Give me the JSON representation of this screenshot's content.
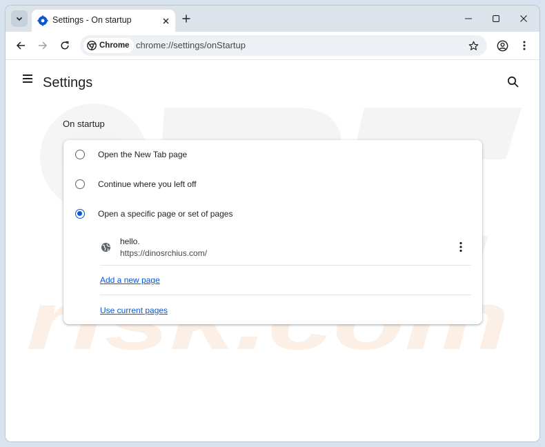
{
  "tab": {
    "title": "Settings - On startup"
  },
  "omnibox": {
    "chip_label": "Chrome",
    "url": "chrome://settings/onStartup"
  },
  "page": {
    "title": "Settings"
  },
  "on_startup": {
    "heading": "On startup",
    "options": [
      {
        "label": "Open the New Tab page",
        "selected": false
      },
      {
        "label": "Continue where you left off",
        "selected": false
      },
      {
        "label": "Open a specific page or set of pages",
        "selected": true
      }
    ],
    "pages": [
      {
        "title": "hello.",
        "url": "https://dinosrchius.com/"
      }
    ],
    "add_page_link": "Add a new page",
    "use_current_link": "Use current pages"
  },
  "watermark": {
    "text": "PC risk.com"
  },
  "colors": {
    "accent": "#0b57d0",
    "watermark_gray": "#ececec",
    "watermark_orange": "#fbe3d2"
  }
}
